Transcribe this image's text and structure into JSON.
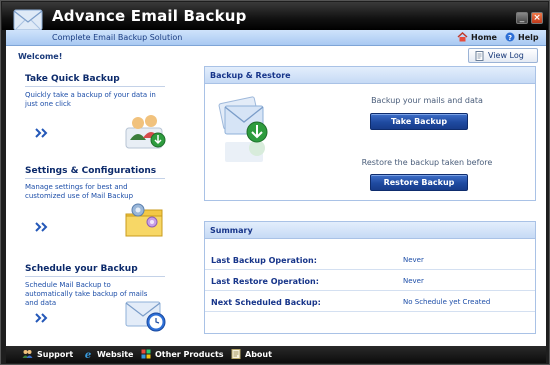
{
  "window": {
    "title": "Advance Email Backup",
    "subtitle": "Complete Email Backup Solution",
    "home_label": "Home",
    "help_label": "Help"
  },
  "left": {
    "welcome": "Welcome!",
    "sections": [
      {
        "title": "Take Quick Backup",
        "desc": "Quickly take a backup of your data in just one click",
        "icon": "users-backup-icon"
      },
      {
        "title": "Settings & Configurations",
        "desc": "Manage settings for best and customized use of Mail Backup",
        "icon": "folder-settings-icon"
      },
      {
        "title": "Schedule your Backup",
        "desc": "Schedule Mail Backup to automatically take backup of mails and data",
        "icon": "mail-clock-icon"
      }
    ]
  },
  "toolbar": {
    "viewlog_label": "View Log"
  },
  "backup_restore": {
    "header": "Backup & Restore",
    "backup_text": "Backup your mails and data",
    "backup_button": "Take Backup",
    "restore_text": "Restore the backup taken before",
    "restore_button": "Restore Backup"
  },
  "summary": {
    "header": "Summary",
    "rows": [
      {
        "label": "Last Backup Operation:",
        "value": "Never"
      },
      {
        "label": "Last Restore Operation:",
        "value": "Never"
      },
      {
        "label": "Next Scheduled Backup:",
        "value": "No Schedule yet Created"
      }
    ]
  },
  "footer": {
    "support": "Support",
    "website": "Website",
    "other_products": "Other Products",
    "about": "About"
  },
  "colors": {
    "accent": "#1f4aa0",
    "title_bar": "#111111",
    "panel_header": "#c6daf5",
    "link_text": "#1d4ea8"
  }
}
